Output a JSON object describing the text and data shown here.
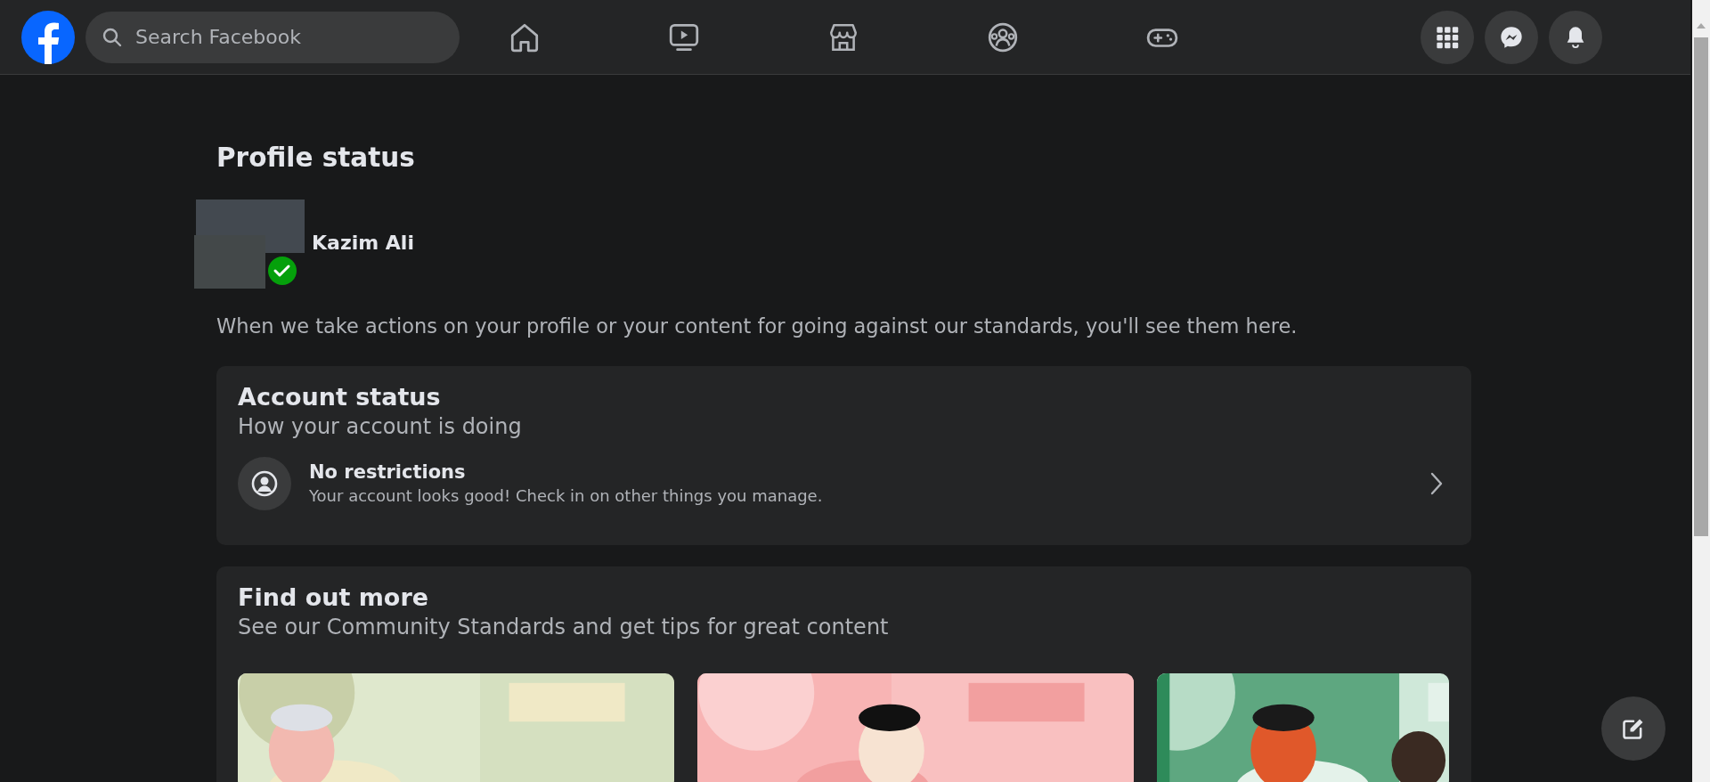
{
  "top_bar": {
    "search": {
      "placeholder": "Search Facebook"
    },
    "nav": [
      {
        "kind": "home",
        "selected": false
      },
      {
        "kind": "video",
        "selected": false
      },
      {
        "kind": "marketplace",
        "selected": false
      },
      {
        "kind": "groups",
        "selected": false
      },
      {
        "kind": "gaming",
        "selected": false
      }
    ],
    "actions": [
      {
        "kind": "menu"
      },
      {
        "kind": "messenger"
      },
      {
        "kind": "notifications"
      }
    ]
  },
  "page": {
    "title": "Profile status",
    "profile": {
      "name": "Kazim Ali",
      "verified": true
    },
    "description": "When we take actions on your profile or your content for going against our standards, you'll see them here."
  },
  "account_status": {
    "title": "Account status",
    "subtitle": "How your account is doing",
    "item": {
      "title": "No restrictions",
      "description": "Your account looks good! Check in on other things you manage."
    }
  },
  "find_out_more": {
    "title": "Find out more",
    "subtitle": "See our Community Standards and get tips for great content"
  }
}
